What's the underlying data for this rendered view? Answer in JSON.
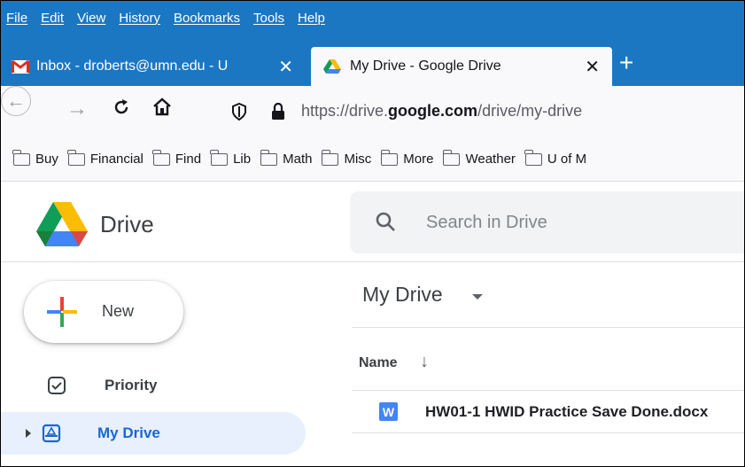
{
  "browser": {
    "menu": [
      "File",
      "Edit",
      "View",
      "History",
      "Bookmarks",
      "Tools",
      "Help"
    ],
    "tabs": [
      {
        "title": "Inbox - droberts@umn.edu - U",
        "icon": "gmail-icon"
      },
      {
        "title": "My Drive - Google Drive",
        "icon": "google-drive-icon"
      }
    ],
    "url_prefix": "https://drive.",
    "url_domain": "google.com",
    "url_path": "/drive/my-drive",
    "bookmarks": [
      "Buy",
      "Financial",
      "Find",
      "Lib",
      "Math",
      "Misc",
      "More",
      "Weather",
      "U of M"
    ]
  },
  "drive": {
    "title": "Drive",
    "search_placeholder": "Search in Drive",
    "new_label": "New",
    "sidebar": [
      {
        "label": "Priority",
        "icon": "priority-icon"
      },
      {
        "label": "My Drive",
        "icon": "my-drive-icon",
        "selected": true
      }
    ],
    "main_title": "My Drive",
    "column_header": "Name",
    "files": [
      {
        "name": "HW01-1 HWID Practice Save Done.docx",
        "type": "word"
      }
    ]
  },
  "colors": {
    "browser_chrome": "#1c77c3",
    "drive_selected": "#e8f0fe",
    "drive_selected_text": "#1967d2",
    "word_blue": "#4285f4"
  }
}
